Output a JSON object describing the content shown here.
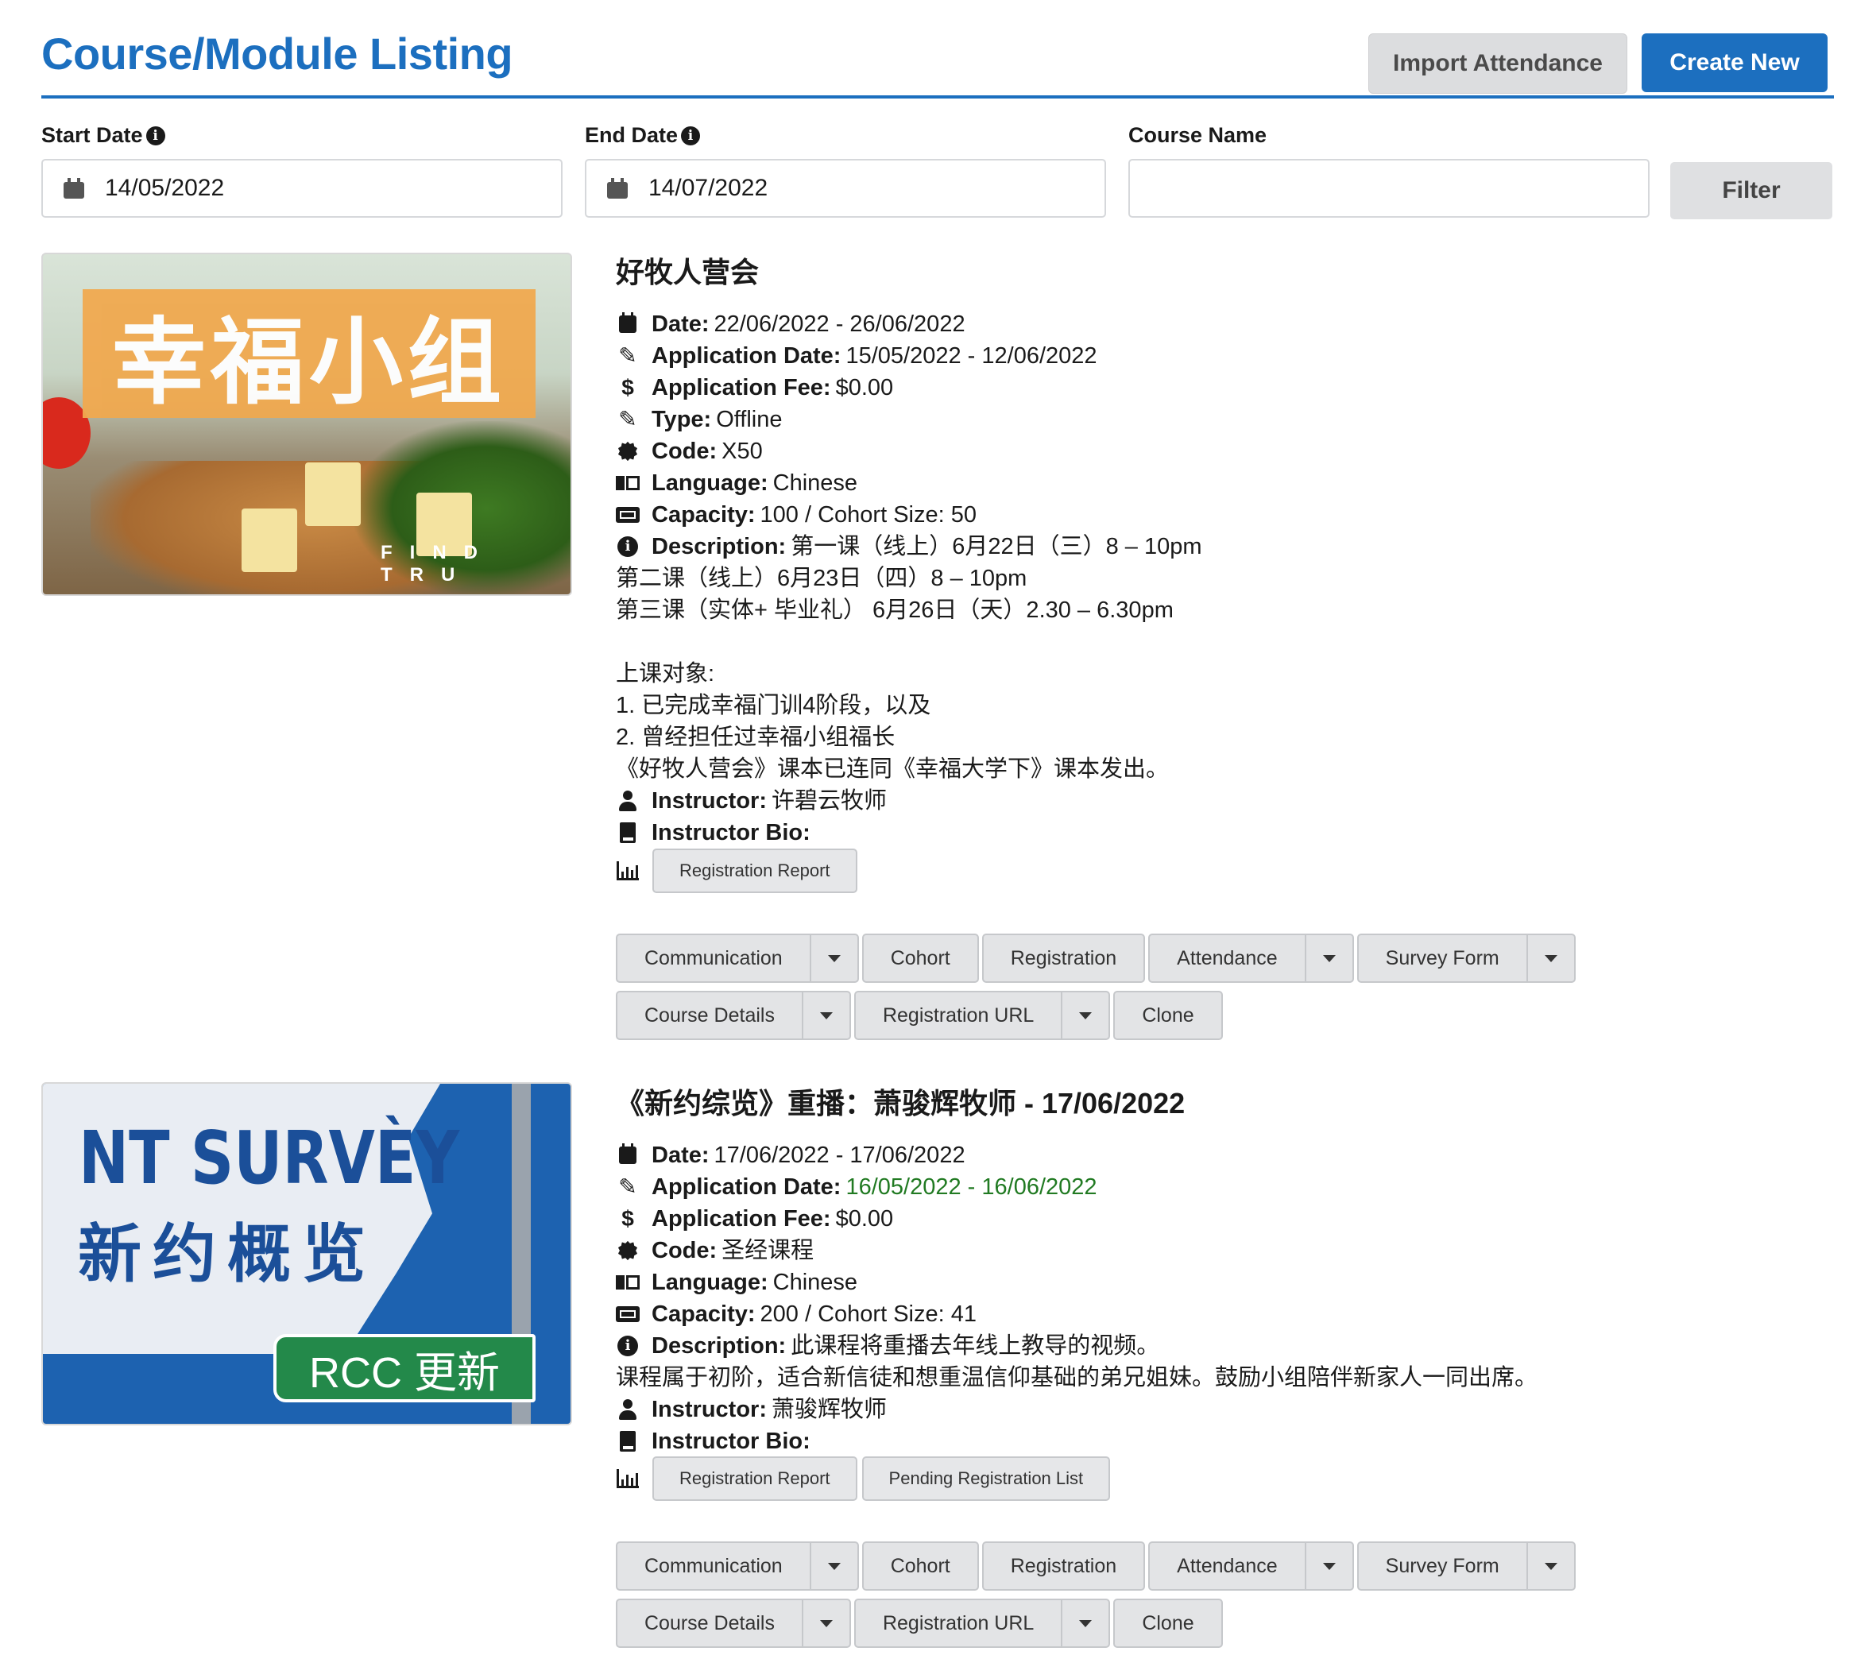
{
  "header": {
    "title": "Course/Module Listing",
    "import_label": "Import Attendance",
    "create_label": "Create New"
  },
  "filters": {
    "start_label": "Start Date",
    "start_value": "14/05/2022",
    "end_label": "End Date",
    "end_value": "14/07/2022",
    "name_label": "Course Name",
    "name_value": "",
    "filter_label": "Filter"
  },
  "courses": [
    {
      "title": "好牧人营会",
      "thumb_text": "幸福小组",
      "thumb_sub": "FIND TRU",
      "date_label": "Date:",
      "date": "22/06/2022 - 26/06/2022",
      "appdate_label": "Application Date:",
      "appdate": "15/05/2022 - 12/06/2022",
      "fee_label": "Application Fee:",
      "fee": "$0.00",
      "type_label": "Type:",
      "type": "Offline",
      "code_label": "Code:",
      "code": "X50",
      "lang_label": "Language:",
      "lang": "Chinese",
      "cap_label": "Capacity:",
      "cap": "100 / Cohort Size: 50",
      "desc_label": "Description:",
      "desc": "第一课（线上）6月22日（三）8 – 10pm",
      "desc_lines": [
        "第二课（线上）6月23日（四）8 – 10pm",
        "第三课（实体+ 毕业礼） 6月26日（天）2.30 – 6.30pm",
        "",
        "上课对象:",
        "1.   已完成幸福门训4阶段，以及",
        "2.   曾经担任过幸福小组福长",
        "《好牧人营会》课本已连同《幸福大学下》课本发出。"
      ],
      "instr_label": "Instructor:",
      "instr": "许碧云牧师",
      "bio_label": "Instructor Bio:",
      "reports": [
        "Registration Report"
      ]
    },
    {
      "title": "《新约综览》重播：萧骏辉牧师 - 17/06/2022",
      "thumb_text": "NT SURVÈY",
      "thumb_cn": "新约概览",
      "thumb_badge": "RCC 更新",
      "date_label": "Date:",
      "date": "17/06/2022 - 17/06/2022",
      "appdate_label": "Application Date:",
      "appdate": "16/05/2022 - 16/06/2022",
      "fee_label": "Application Fee:",
      "fee": "$0.00",
      "code_label": "Code:",
      "code": "圣经课程",
      "lang_label": "Language:",
      "lang": "Chinese",
      "cap_label": "Capacity:",
      "cap": "200 / Cohort Size: 41",
      "desc_label": "Description:",
      "desc": "此课程将重播去年线上教导的视频。",
      "desc_lines": [
        "课程属于初阶，适合新信徒和想重温信仰基础的弟兄姐妹。鼓励小组陪伴新家人一同出席。"
      ],
      "instr_label": "Instructor:",
      "instr": "萧骏辉牧师",
      "bio_label": "Instructor Bio:",
      "reports": [
        "Registration Report",
        "Pending Registration List"
      ]
    }
  ],
  "actions": {
    "communication": "Communication",
    "cohort": "Cohort",
    "registration": "Registration",
    "attendance": "Attendance",
    "survey": "Survey Form",
    "details": "Course Details",
    "reg_url": "Registration URL",
    "clone": "Clone"
  },
  "colors": {
    "primary": "#1c6fbf",
    "app_date_open": "#217a22"
  }
}
